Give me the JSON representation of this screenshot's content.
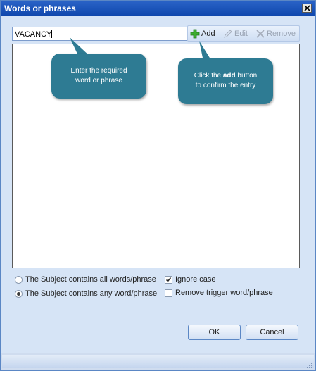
{
  "window": {
    "title": "Words or phrases"
  },
  "input": {
    "value": "VACANCY"
  },
  "toolbar": {
    "add_label": "Add",
    "edit_label": "Edit",
    "remove_label": "Remove"
  },
  "callouts": {
    "enter": {
      "line1": "Enter the required",
      "line2": "word or phrase"
    },
    "click": {
      "line1_pre": "Click the ",
      "line1_bold": "add",
      "line1_post": " button",
      "line2": "to confirm the entry"
    }
  },
  "options": {
    "all_words": {
      "label": "The Subject contains all words/phrase",
      "selected": false
    },
    "any_word": {
      "label": "The Subject contains any word/phrase",
      "selected": true
    },
    "ignore_case": {
      "label": "Ignore case",
      "checked": true
    },
    "remove_trigger": {
      "label": "Remove trigger word/phrase",
      "checked": false
    }
  },
  "buttons": {
    "ok": "OK",
    "cancel": "Cancel"
  },
  "colors": {
    "titlebar": "#0f47ad",
    "window_bg": "#d6e4f6",
    "callout": "#2e7b93",
    "add_icon": "#3dac2f"
  },
  "icons": {
    "add": "plus-icon",
    "edit": "pencil-icon",
    "remove": "x-icon",
    "close": "close-icon"
  }
}
